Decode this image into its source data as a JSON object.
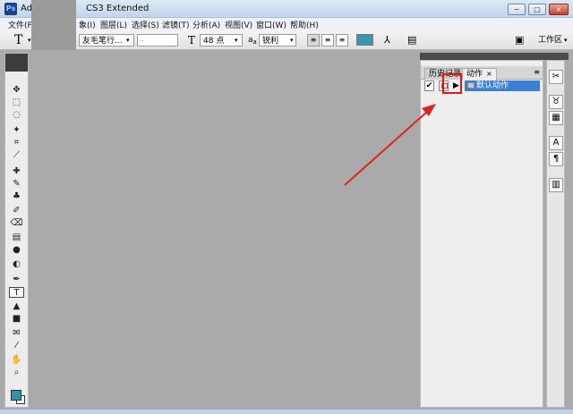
{
  "window": {
    "app_icon": "Ps",
    "title": "Adob",
    "title_suffix": "CS3 Extended",
    "controls": [
      "−",
      "□",
      "×"
    ]
  },
  "menu": {
    "items": [
      "文件(F)",
      "象(I)",
      "图层(L)",
      "选择(S)",
      "滤镜(T)",
      "分析(A)",
      "视图(V)",
      "窗口(W)",
      "帮助(H)"
    ]
  },
  "options": {
    "tool_glyph": "T",
    "font_family": "友毛笔行...",
    "font_style": "-",
    "size_label": "T",
    "font_size": "48 点",
    "aa_label": "a",
    "aa_suffix": "a",
    "antialias": "锐利",
    "workspace_label": "工作区",
    "dropdown_glyph": "▾"
  },
  "tools": {
    "icons": [
      "move-icon",
      "marquee-icon",
      "lasso-icon",
      "magic-wand-icon",
      "crop-icon",
      "slice-icon",
      "healing-brush-icon",
      "brush-icon",
      "clone-stamp-icon",
      "history-brush-icon",
      "eraser-icon",
      "gradient-icon",
      "blur-icon",
      "dodge-icon",
      "pen-icon",
      "type-icon",
      "path-selection-icon",
      "rectangle-icon",
      "notes-icon",
      "eyedropper-icon",
      "hand-icon",
      "zoom-icon"
    ],
    "glyphs": [
      "✥",
      "⬚",
      "◌",
      "✦",
      "⌗",
      "⟋",
      "✚",
      "✎",
      "♣",
      "✐",
      "⌫",
      "▤",
      "●",
      "◐",
      "✒",
      "T",
      "▲",
      "■",
      "✉",
      "⁄",
      "✋",
      "⌕"
    ],
    "colors": {
      "foreground": "#2e93a8",
      "background": "#ffffff"
    }
  },
  "actions_panel": {
    "tabs": [
      "历史记录",
      "动作"
    ],
    "active_tab": "动作",
    "tab_close": "×",
    "menu_glyph": "≡",
    "check_glyph": "✔",
    "expand_glyph": "▶",
    "set_name": "默认动作"
  },
  "dock": {
    "icons": [
      "tool-presets-icon",
      "navigator-icon",
      "layers-icon",
      "character-icon",
      "paragraph-icon",
      "histogram-icon"
    ],
    "glyphs": [
      "✂",
      "♉",
      "▦",
      "A",
      "¶",
      "▥"
    ]
  },
  "annotation": {
    "color": "#dd2222"
  }
}
